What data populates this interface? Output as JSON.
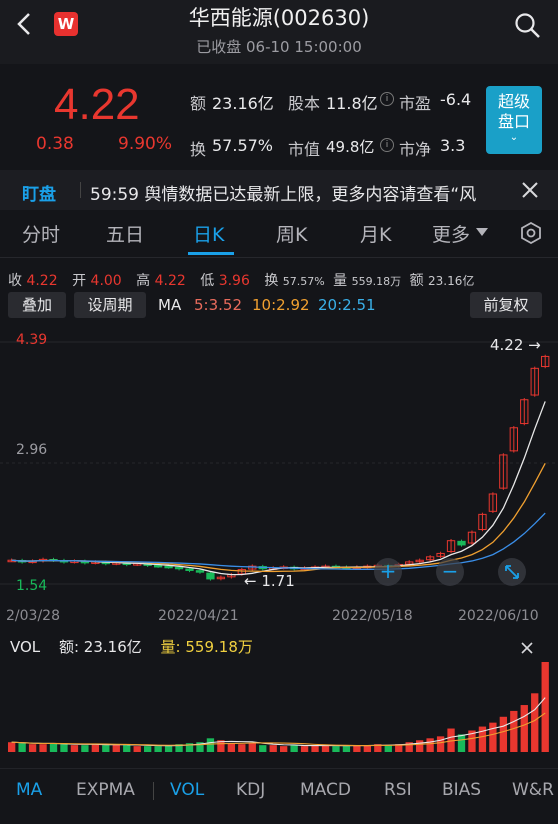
{
  "header": {
    "title": "华西能源(002630)",
    "status": "已收盘 06-10 15:00:00",
    "logo_letter": "W"
  },
  "quote": {
    "price": "4.22",
    "change": "0.38",
    "change_pct": "9.90%",
    "amount_label": "额",
    "amount": "23.16亿",
    "equity_label": "股本",
    "equity": "11.8亿",
    "pe_label": "市盈",
    "pe": "-6.4",
    "turnover_label": "换",
    "turnover": "57.57%",
    "mcap_label": "市值",
    "mcap": "49.8亿",
    "pb_label": "市净",
    "pb": "3.3",
    "super_btn_line1": "超级",
    "super_btn_line2": "盘口"
  },
  "news": {
    "tag": "盯盘",
    "text": "59:59 舆情数据已达最新上限，更多内容请查看“风"
  },
  "tabs": [
    "分时",
    "五日",
    "日K",
    "周K",
    "月K",
    "更多"
  ],
  "ohlc": {
    "close_label": "收",
    "close": "4.22",
    "open_label": "开",
    "open": "4.00",
    "high_label": "高",
    "high": "4.22",
    "low_label": "低",
    "low": "3.96",
    "turn_label": "换",
    "turn": "57.57%",
    "vol_label": "量",
    "vol": "559.18万",
    "amt_label": "额",
    "amt": "23.16亿"
  },
  "toolbar": {
    "overlay": "叠加",
    "period": "设周期",
    "ma_label": "MA",
    "ma5": "5:3.52",
    "ma10": "10:2.92",
    "ma20": "20:2.51",
    "adjust": "前复权"
  },
  "chart": {
    "y_high": "4.39",
    "y_mid": "2.96",
    "y_low": "1.54",
    "max_marker": "4.22",
    "min_marker": "1.71",
    "dates": [
      "2/03/28",
      "2022/04/21",
      "2022/05/18",
      "2022/06/10"
    ]
  },
  "volume": {
    "label": "VOL",
    "amt_label": "额:",
    "amt": "23.16亿",
    "vol_label": "量:",
    "vol": "559.18万"
  },
  "indicators": [
    "MA",
    "EXPMA",
    "VOL",
    "KDJ",
    "MACD",
    "RSI",
    "BIAS",
    "W&R"
  ],
  "colors": {
    "up": "#e8372f",
    "down": "#19b95a",
    "accent": "#1aa0e8",
    "ma5": "#e8e8e8",
    "ma10": "#f0a030",
    "ma20": "#3a8ee8"
  },
  "chart_data": {
    "type": "candlestick",
    "ylim": [
      1.54,
      4.39
    ],
    "closes": [
      1.82,
      1.8,
      1.81,
      1.83,
      1.82,
      1.8,
      1.81,
      1.79,
      1.8,
      1.78,
      1.79,
      1.77,
      1.78,
      1.76,
      1.75,
      1.74,
      1.72,
      1.7,
      1.68,
      1.6,
      1.62,
      1.65,
      1.71,
      1.75,
      1.72,
      1.73,
      1.74,
      1.72,
      1.73,
      1.74,
      1.75,
      1.74,
      1.73,
      1.74,
      1.75,
      1.76,
      1.75,
      1.77,
      1.8,
      1.82,
      1.86,
      1.9,
      2.05,
      2.0,
      2.15,
      2.36,
      2.6,
      3.06,
      3.38,
      3.71,
      4.08,
      4.22
    ],
    "volumes": [
      10,
      9,
      8,
      8,
      9,
      8,
      7,
      7,
      8,
      7,
      8,
      7,
      6,
      6,
      6,
      7,
      8,
      9,
      10,
      14,
      12,
      9,
      8,
      9,
      7,
      7,
      6,
      7,
      6,
      7,
      7,
      6,
      6,
      7,
      7,
      8,
      7,
      8,
      10,
      12,
      14,
      16,
      24,
      18,
      22,
      26,
      30,
      36,
      42,
      48,
      60,
      92
    ]
  }
}
